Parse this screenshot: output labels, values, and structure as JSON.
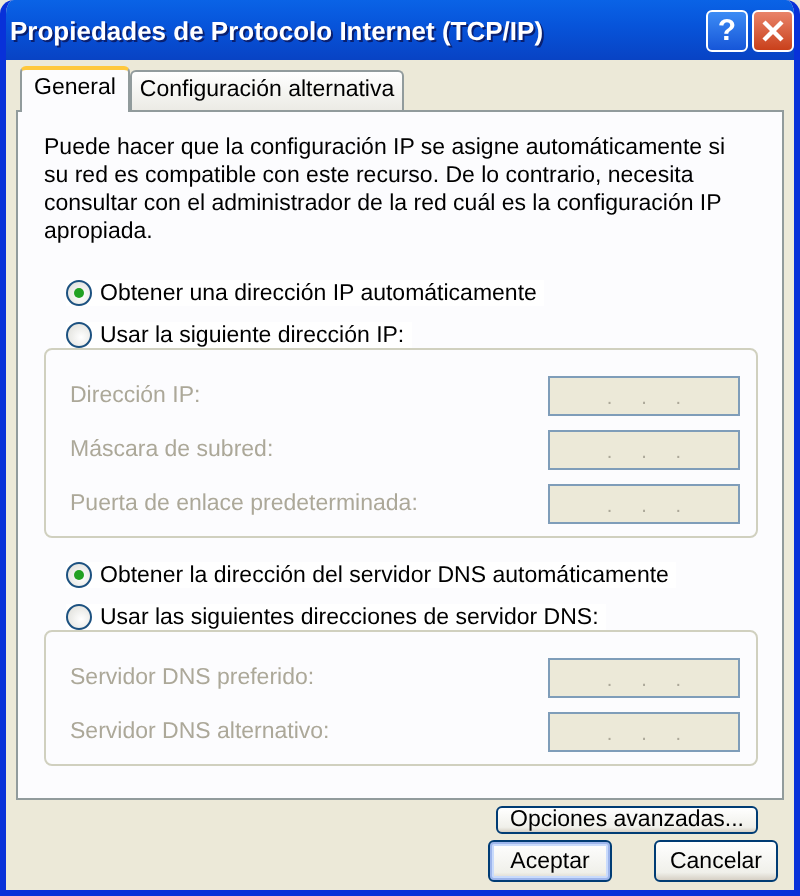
{
  "window": {
    "title": "Propiedades de Protocolo Internet (TCP/IP)",
    "help_button": {
      "label": "?"
    }
  },
  "tabs": [
    {
      "label": "General",
      "selected": true
    },
    {
      "label": "Configuración alternativa",
      "selected": false
    }
  ],
  "description": "Puede hacer que la configuración IP se asigne automáticamente si su red es compatible con este recurso. De lo contrario, necesita consultar con el administrador de la red cuál es la configuración IP apropiada.",
  "options": [
    {
      "kind": "radio",
      "label": "Obtener una dirección IP automáticamente",
      "selected": true
    },
    {
      "kind": "group",
      "radio": {
        "label": "Usar la siguiente dirección IP:",
        "selected": false
      },
      "fields": [
        {
          "label": "Dirección IP:",
          "disabled": true,
          "separators": [
            ".",
            ".",
            "."
          ]
        },
        {
          "label": "Máscara de subred:",
          "disabled": true,
          "separators": [
            ".",
            ".",
            "."
          ]
        },
        {
          "label": "Puerta de enlace predeterminada:",
          "disabled": true,
          "separators": [
            ".",
            ".",
            "."
          ]
        }
      ]
    },
    {
      "kind": "radio",
      "label": "Obtener la dirección del servidor DNS automáticamente",
      "selected": true
    },
    {
      "kind": "group",
      "radio": {
        "label": "Usar las siguientes direcciones de servidor DNS:",
        "selected": false
      },
      "fields": [
        {
          "label": "Servidor DNS preferido:",
          "disabled": true,
          "separators": [
            ".",
            ".",
            "."
          ]
        },
        {
          "label": "Servidor DNS alternativo:",
          "disabled": true,
          "separators": [
            ".",
            ".",
            "."
          ]
        }
      ]
    }
  ],
  "advanced_button": {
    "label": "Opciones avanzadas..."
  },
  "footer_buttons": [
    {
      "label": "Aceptar",
      "default": true
    },
    {
      "label": "Cancelar",
      "default": false
    }
  ]
}
